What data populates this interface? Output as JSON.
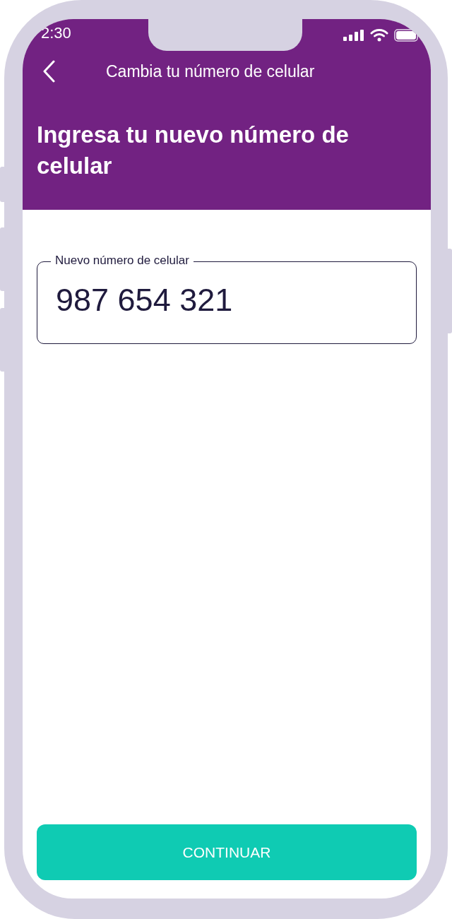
{
  "status_bar": {
    "time": "2:30"
  },
  "nav_bar": {
    "title": "Cambia tu número de celular"
  },
  "heading": "Ingresa tu nuevo número de celular",
  "phone_field": {
    "label": "Nuevo número de celular",
    "value": "987 654 321"
  },
  "buttons": [
    {
      "label": "CONTINUAR"
    }
  ]
}
